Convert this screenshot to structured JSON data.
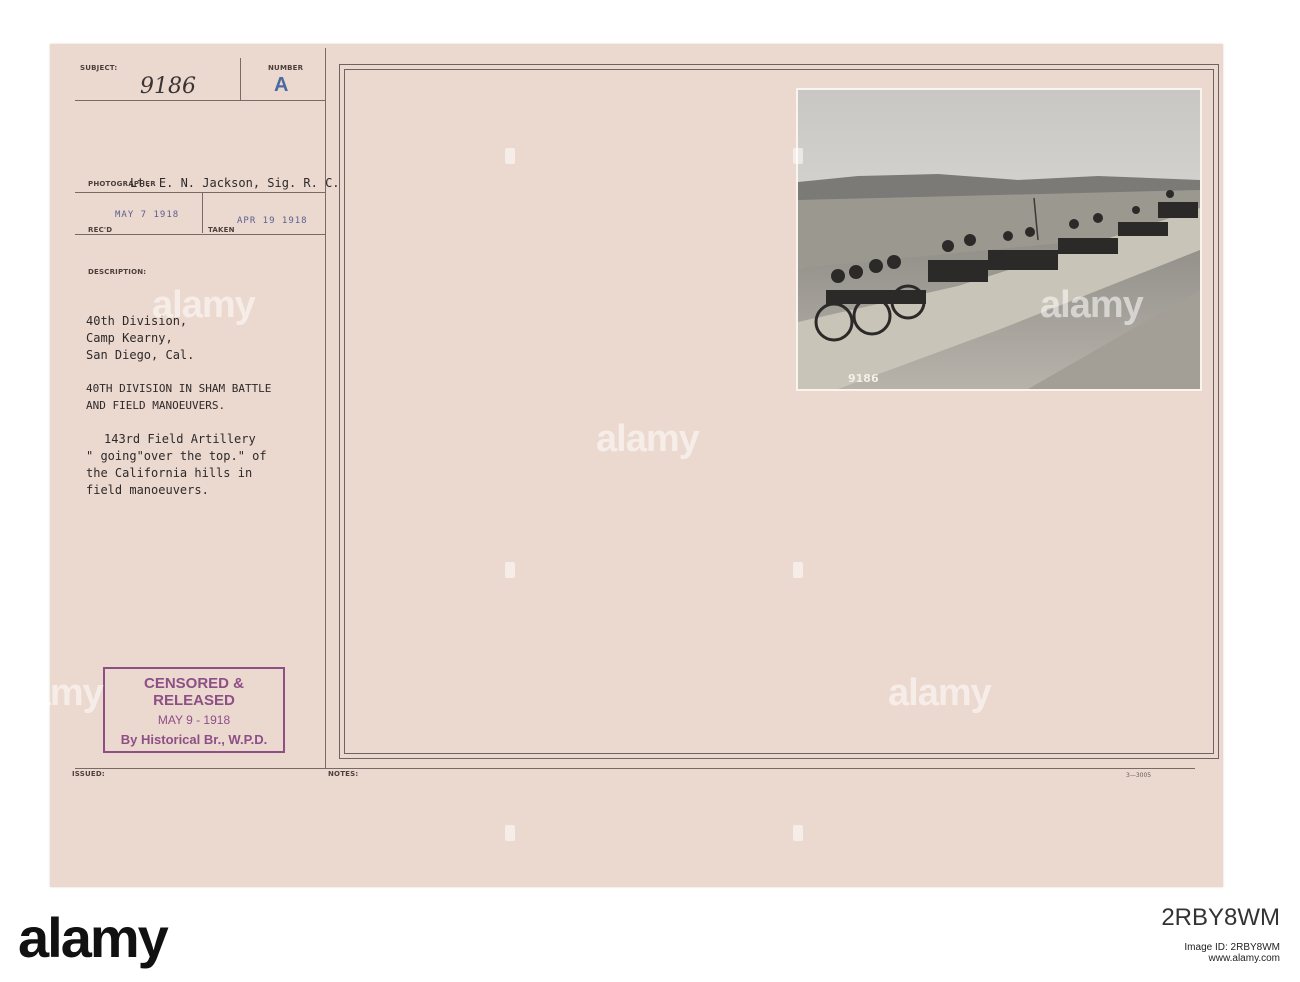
{
  "labels": {
    "subject": "SUBJECT:",
    "number": "NUMBER",
    "photographer": "PHOTOGRAPHER",
    "recd": "REC'D",
    "taken": "TAKEN",
    "description": "DESCRIPTION:",
    "issued": "ISSUED:",
    "notes": "NOTES:"
  },
  "fields": {
    "subject_no": "9186",
    "number": "A",
    "photographer": "Lt. E. N. Jackson, Sig. R. C.",
    "recd_date": "MAY 7 1918",
    "taken_date": "APR 19 1918"
  },
  "description": {
    "location": [
      "40th Division,",
      "Camp Kearny,",
      "San Diego, Cal."
    ],
    "heading": [
      "40TH DIVISION IN SHAM BATTLE",
      "AND FIELD MANOEUVERS."
    ],
    "body": [
      "143rd Field Artillery",
      "\" going\"over the top.\" of",
      "the California hills in",
      "field manoeuvers."
    ]
  },
  "stamp": {
    "line1": "CENSORED & RELEASED",
    "line2": "MAY 9 - 1918",
    "line3": "By Historical Br., W.P.D."
  },
  "photo": {
    "caption": "9186"
  },
  "form_number": "3—3005",
  "watermark": "alamy",
  "footer": {
    "logo": "alamy",
    "image_id": "2RBY8WM",
    "meta": "Image ID: 2RBY8WM\nwww.alamy.com"
  },
  "colors": {
    "paper": "#ebd8cf",
    "stamp": "#8e4f86",
    "date_stamp": "#5a5f92"
  }
}
